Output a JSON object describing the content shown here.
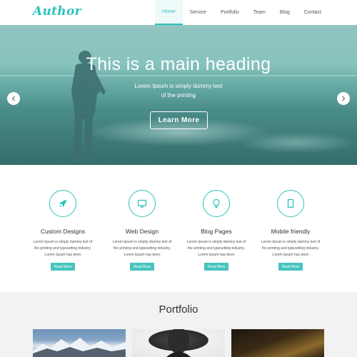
{
  "brand": {
    "logo": "Author",
    "accent": "#2ec3bd"
  },
  "nav": {
    "items": [
      {
        "label": "Home",
        "active": true
      },
      {
        "label": "Service"
      },
      {
        "label": "Portfolio"
      },
      {
        "label": "Team"
      },
      {
        "label": "Blog"
      },
      {
        "label": "Contact"
      }
    ]
  },
  "hero": {
    "heading": "This is a main heading",
    "subtext_line1": "Lorem Ipsum is simply dummy text",
    "subtext_line2": "of the printing",
    "button": "Learn More",
    "prev_icon": "chevron-left-icon",
    "next_icon": "chevron-right-icon"
  },
  "services": [
    {
      "icon": "rocket-icon",
      "title": "Custom Designs",
      "text1": "Lorem Ipsum is simply dummy text of",
      "text2": "the printing and typesetting industry.",
      "text3": "Lorem Ipsum has been",
      "button": "Read More"
    },
    {
      "icon": "monitor-icon",
      "title": "Web Design",
      "text1": "Lorem Ipsum is simply dummy text of",
      "text2": "the printing and typesetting industry.",
      "text3": "Lorem Ipsum has been",
      "button": "Read More"
    },
    {
      "icon": "lightbulb-icon",
      "title": "Blog Pages",
      "text1": "Lorem Ipsum is simply dummy text of",
      "text2": "the printing and typesetting industry.",
      "text3": "Lorem Ipsum has been",
      "button": "Read More"
    },
    {
      "icon": "tablet-icon",
      "title": "Mobile friendly",
      "text1": "Lorem Ipsum is simply dummy text of",
      "text2": "the printing and typesetting industry.",
      "text3": "Lorem Ipsum has been",
      "button": "Read More"
    }
  ],
  "portfolio": {
    "title": "Portfolio"
  }
}
